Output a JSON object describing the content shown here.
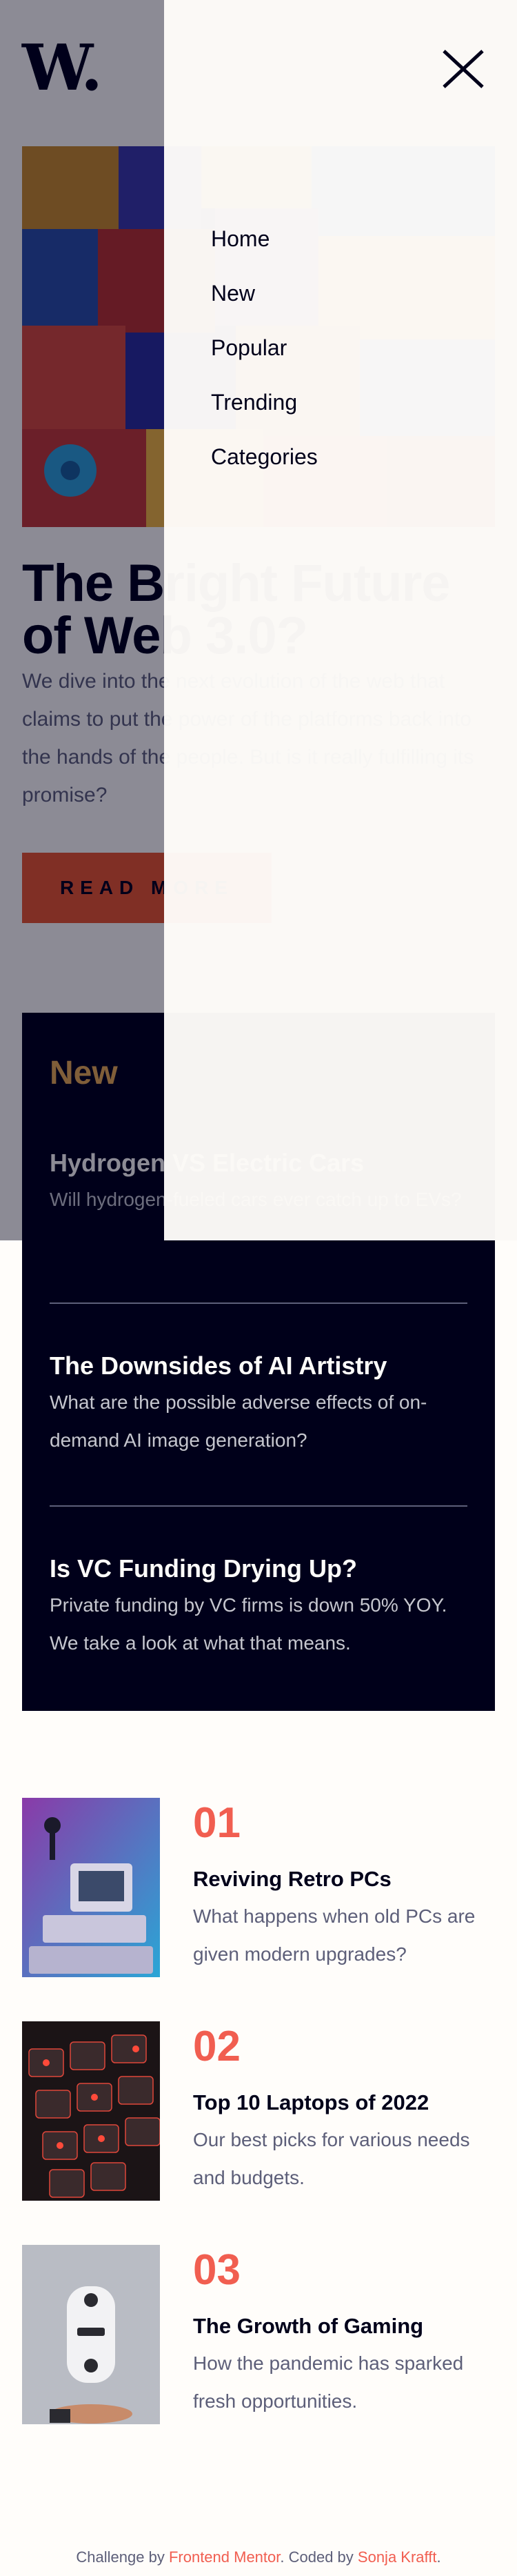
{
  "brand": {
    "logo_text": "W",
    "logo_dot": "."
  },
  "hero": {
    "title": "The Bright Future of Web 3.0?",
    "description": "We dive into the next evolution of the web that claims to put the power of the platforms back into the hands of the people. But is it really fulfilling its promise?",
    "button_label": "READ MORE",
    "image_icon": "abstract-blocks-image"
  },
  "new_section": {
    "heading": "New",
    "items": [
      {
        "title": "Hydrogen VS Electric Cars",
        "description": "Will hydrogen-fueled cars ever catch up to EVs?"
      },
      {
        "title": "The Downsides of AI Artistry",
        "description": "What are the possible adverse effects of on-demand AI image generation?"
      },
      {
        "title": "Is VC Funding Drying Up?",
        "description": "Private funding by VC firms is down 50% YOY. We take a look at what that means."
      }
    ]
  },
  "ranked": [
    {
      "number": "01",
      "title": "Reviving Retro PCs",
      "description": "What happens when old PCs are given modern upgrades?",
      "image_icon": "retro-pc-image"
    },
    {
      "number": "02",
      "title": "Top 10 Laptops of 2022",
      "description": "Our best picks for various needs and budgets.",
      "image_icon": "keyboard-image"
    },
    {
      "number": "03",
      "title": "The Growth of Gaming",
      "description": "How the pandemic has sparked fresh opportunities.",
      "image_icon": "gamepad-image"
    }
  ],
  "footer": {
    "prefix": "Challenge by ",
    "challenge_link": "Frontend Mentor",
    "middle": ". Coded by ",
    "author_link": "Sonja Krafft",
    "suffix": "."
  },
  "menu": {
    "items": [
      "Home",
      "New",
      "Popular",
      "Trending",
      "Categories"
    ],
    "close_icon": "close-icon"
  },
  "colors": {
    "accent_red": "#f15e50",
    "accent_orange": "#e9ab53",
    "button_red": "#e9562f",
    "dark": "#00001a",
    "off_white": "#fffdfa"
  }
}
